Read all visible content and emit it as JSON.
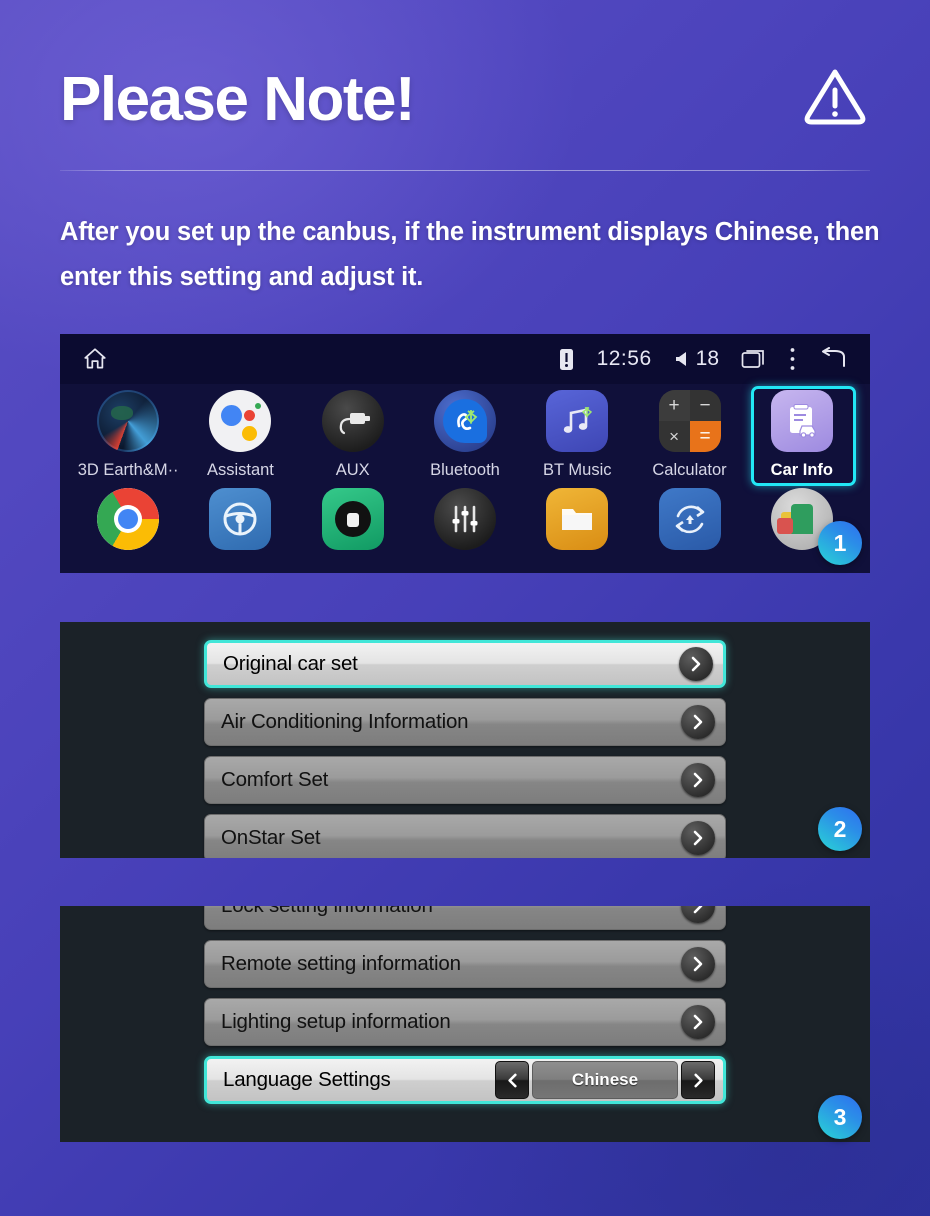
{
  "header": {
    "title": "Please Note!",
    "warning_icon": "warning-triangle-icon"
  },
  "intro": {
    "text": "After you set up the canbus, if the instrument displays Chinese, then enter this setting and adjust it."
  },
  "launcher": {
    "statusbar": {
      "home_icon": "home-icon",
      "alert_icon": "alert-badge-icon",
      "time": "12:56",
      "volume_icon": "volume-icon",
      "volume": "18",
      "recents_icon": "recents-icon",
      "menu_icon": "overflow-menu-icon",
      "back_icon": "back-arrow-icon"
    },
    "apps_row1": [
      {
        "label": "3D Earth&M··",
        "icon": "earth-icon",
        "selected": false
      },
      {
        "label": "Assistant",
        "icon": "assistant-icon",
        "selected": false
      },
      {
        "label": "AUX",
        "icon": "aux-icon",
        "selected": false
      },
      {
        "label": "Bluetooth",
        "icon": "bluetooth-phone-icon",
        "selected": false
      },
      {
        "label": "BT Music",
        "icon": "bt-music-icon",
        "selected": false
      },
      {
        "label": "Calculator",
        "icon": "calculator-icon",
        "selected": false
      },
      {
        "label": "Car Info",
        "icon": "car-info-icon",
        "selected": true
      }
    ],
    "apps_row2": [
      {
        "icon": "chrome-icon"
      },
      {
        "icon": "steering-wheel-icon"
      },
      {
        "icon": "camera-icon"
      },
      {
        "icon": "equalizer-icon"
      },
      {
        "icon": "file-manager-icon"
      },
      {
        "icon": "sync-update-icon"
      },
      {
        "icon": "gallery-icon"
      }
    ]
  },
  "menu_panel": {
    "rows": [
      {
        "label": "Original car set",
        "highlighted": true
      },
      {
        "label": "Air Conditioning Information",
        "highlighted": false
      },
      {
        "label": "Comfort Set",
        "highlighted": false
      },
      {
        "label": "OnStar Set",
        "highlighted": false
      }
    ]
  },
  "language_panel": {
    "rows": [
      {
        "label": "Lock setting information",
        "highlighted": false
      },
      {
        "label": "Remote setting information",
        "highlighted": false
      },
      {
        "label": "Lighting setup information",
        "highlighted": false
      }
    ],
    "language_row": {
      "label": "Language Settings",
      "prev_icon": "chevron-left-icon",
      "value": "Chinese",
      "next_icon": "chevron-right-icon"
    }
  },
  "badges": {
    "one": "1",
    "two": "2",
    "three": "3"
  },
  "colors": {
    "accent_cyan": "#22e7f5",
    "highlight_border": "#41e6d8",
    "panel_dark": "#1b2228",
    "launcher_bg": "#10103a"
  }
}
